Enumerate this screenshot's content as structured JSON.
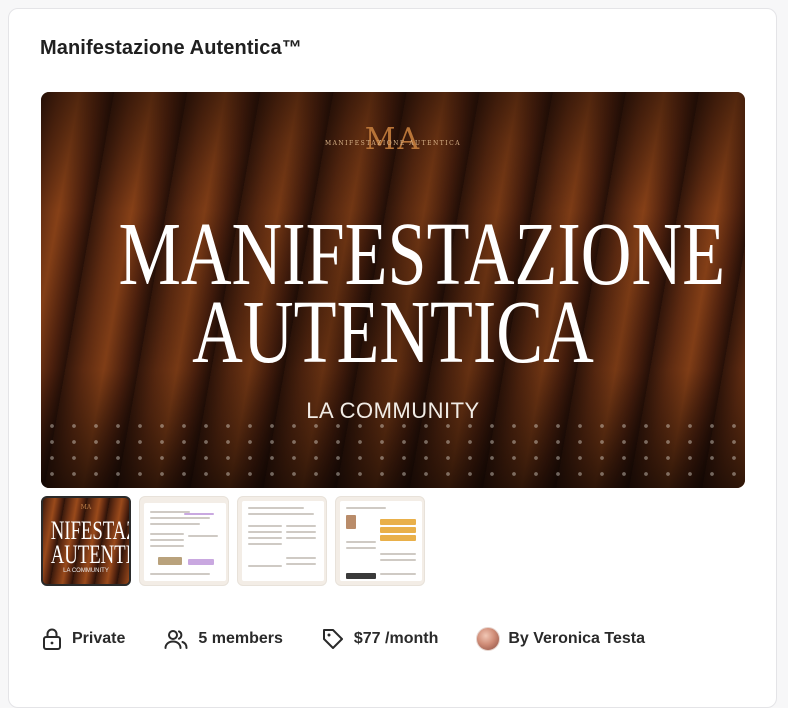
{
  "group": {
    "title": "Manifestazione Autentica™"
  },
  "hero": {
    "logo_monogram": "MA",
    "logo_caption": "MANIFESTAZIONE AUTENTICA",
    "headline_line1": "MANIFESTAZIONE",
    "headline_line2": "AUTENTICA",
    "tagline": "LA COMMUNITY"
  },
  "thumbnails": [
    {
      "label_line1": "NIFESTAZIO",
      "label_line2": "AUTENTICA",
      "tagline": "LA COMMUNITY",
      "logo": "MA",
      "selected": true
    },
    {
      "selected": false
    },
    {
      "selected": false
    },
    {
      "selected": false
    }
  ],
  "meta": {
    "privacy": "Private",
    "members": "5 members",
    "price": "$77 /month",
    "owner": "By Veronica Testa"
  },
  "icons": {
    "privacy": "lock-icon",
    "members": "users-icon",
    "price": "tag-icon"
  },
  "colors": {
    "accent_orange": "#9a4a1b",
    "text_dark": "#202020",
    "card_border": "#e4e4e7"
  }
}
